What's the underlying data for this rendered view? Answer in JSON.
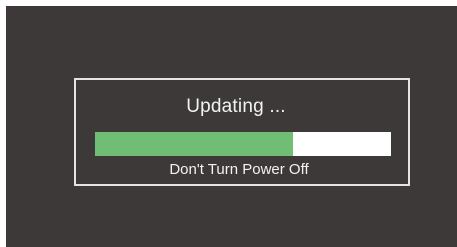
{
  "dialog": {
    "title": "Updating ...",
    "message": "Don't Turn Power Off",
    "progress_fraction": 0.67
  },
  "colors": {
    "screen_background": "#3d3939",
    "progress_fill": "#6fbe73",
    "progress_track": "#ffffff",
    "text": "#f2f2f2",
    "border": "#e4e4e4"
  }
}
